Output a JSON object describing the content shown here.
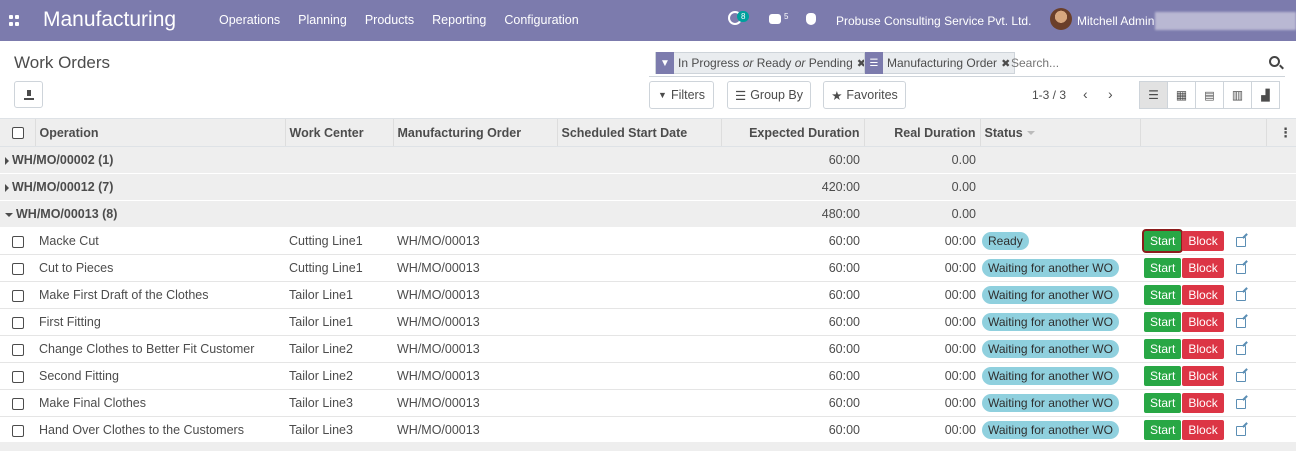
{
  "navbar": {
    "app_title": "Manufacturing",
    "menu": [
      "Operations",
      "Planning",
      "Products",
      "Reporting",
      "Configuration"
    ],
    "activity_count": "8",
    "messages_count": "5",
    "company": "Probuse Consulting Service Pvt. Ltd.",
    "user": "Mitchell Admin",
    "color": "#7c7bad"
  },
  "control_panel": {
    "title": "Work Orders",
    "facets": [
      {
        "icon": "filter-icon",
        "label": "In Progress or Ready or Pending"
      },
      {
        "icon": "group-by-icon",
        "label": "Manufacturing Order"
      }
    ],
    "search_placeholder": "Search...",
    "filters_label": "Filters",
    "group_by_label": "Group By",
    "favorites_label": "Favorites",
    "pager": "1-3 / 3",
    "views": [
      "list-view-icon",
      "kanban-view-icon",
      "calendar-view-icon",
      "pivot-view-icon",
      "graph-view-icon"
    ]
  },
  "table": {
    "columns": {
      "operation": "Operation",
      "work_center": "Work Center",
      "mo": "Manufacturing Order",
      "start_date": "Scheduled Start Date",
      "expected": "Expected Duration",
      "real": "Real Duration",
      "status": "Status"
    },
    "groups": [
      {
        "name": "WH/MO/00002 (1)",
        "expected": "60:00",
        "real": "0.00",
        "expanded": false
      },
      {
        "name": "WH/MO/00012 (7)",
        "expected": "420:00",
        "real": "0.00",
        "expanded": false
      },
      {
        "name": "WH/MO/00013 (8)",
        "expected": "480:00",
        "real": "0.00",
        "expanded": true
      }
    ],
    "rows": [
      {
        "operation": "Macke Cut",
        "work_center": "Cutting Line1",
        "mo": "WH/MO/00013",
        "expected": "60:00",
        "real": "00:00",
        "status": "Ready"
      },
      {
        "operation": "Cut to Pieces",
        "work_center": "Cutting Line1",
        "mo": "WH/MO/00013",
        "expected": "60:00",
        "real": "00:00",
        "status": "Waiting for another WO"
      },
      {
        "operation": "Make First Draft of the Clothes",
        "work_center": "Tailor Line1",
        "mo": "WH/MO/00013",
        "expected": "60:00",
        "real": "00:00",
        "status": "Waiting for another WO"
      },
      {
        "operation": "First Fitting",
        "work_center": "Tailor Line1",
        "mo": "WH/MO/00013",
        "expected": "60:00",
        "real": "00:00",
        "status": "Waiting for another WO"
      },
      {
        "operation": "Change Clothes to Better Fit Customer",
        "work_center": "Tailor Line2",
        "mo": "WH/MO/00013",
        "expected": "60:00",
        "real": "00:00",
        "status": "Waiting for another WO"
      },
      {
        "operation": "Second Fitting",
        "work_center": "Tailor Line2",
        "mo": "WH/MO/00013",
        "expected": "60:00",
        "real": "00:00",
        "status": "Waiting for another WO"
      },
      {
        "operation": "Make Final Clothes",
        "work_center": "Tailor Line3",
        "mo": "WH/MO/00013",
        "expected": "60:00",
        "real": "00:00",
        "status": "Waiting for another WO"
      },
      {
        "operation": "Hand Over Clothes to the Customers",
        "work_center": "Tailor Line3",
        "mo": "WH/MO/00013",
        "expected": "60:00",
        "real": "00:00",
        "status": "Waiting for another WO"
      }
    ],
    "start_label": "Start",
    "block_label": "Block"
  }
}
